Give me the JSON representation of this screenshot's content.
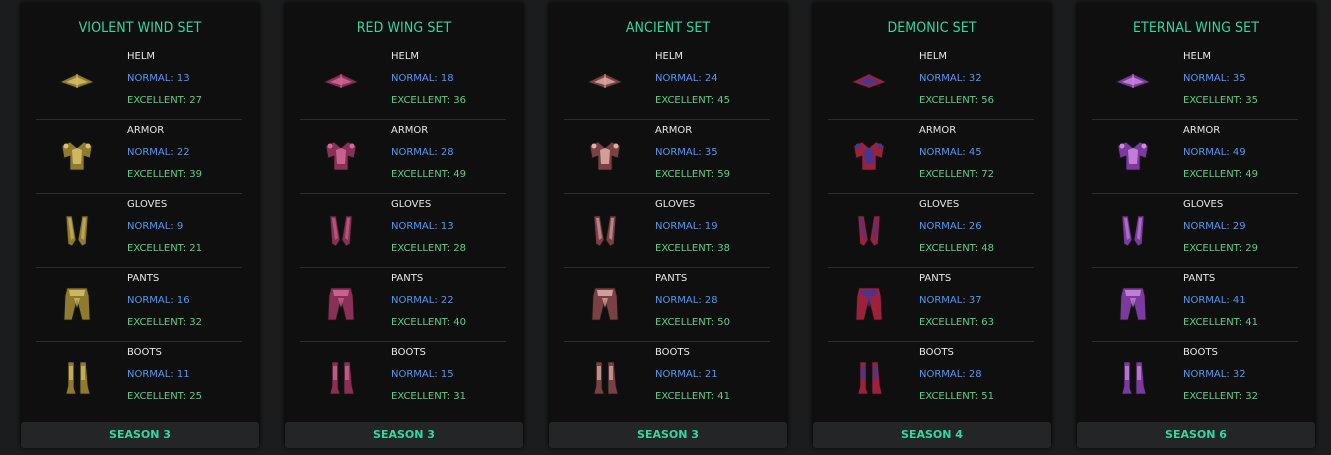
{
  "sets": [
    {
      "title": "VIOLENT WIND SET",
      "season": "SEASON 3",
      "colors": {
        "main": "#8f7a2d",
        "accent": "#d6c36a"
      },
      "items": [
        {
          "name": "HELM",
          "normal": "NORMAL: 13",
          "excellent": "EXCELLENT: 27",
          "icon": "helm-icon"
        },
        {
          "name": "ARMOR",
          "normal": "NORMAL: 22",
          "excellent": "EXCELLENT: 39",
          "icon": "armor-icon"
        },
        {
          "name": "GLOVES",
          "normal": "NORMAL: 9",
          "excellent": "EXCELLENT: 21",
          "icon": "gloves-icon"
        },
        {
          "name": "PANTS",
          "normal": "NORMAL: 16",
          "excellent": "EXCELLENT: 32",
          "icon": "pants-icon"
        },
        {
          "name": "BOOTS",
          "normal": "NORMAL: 11",
          "excellent": "EXCELLENT: 25",
          "icon": "boots-icon"
        }
      ]
    },
    {
      "title": "RED WING SET",
      "season": "SEASON 3",
      "colors": {
        "main": "#8a2f55",
        "accent": "#d46a9a"
      },
      "items": [
        {
          "name": "HELM",
          "normal": "NORMAL: 18",
          "excellent": "EXCELLENT: 36",
          "icon": "helm-icon"
        },
        {
          "name": "ARMOR",
          "normal": "NORMAL: 28",
          "excellent": "EXCELLENT: 49",
          "icon": "armor-icon"
        },
        {
          "name": "GLOVES",
          "normal": "NORMAL: 13",
          "excellent": "EXCELLENT: 28",
          "icon": "gloves-icon"
        },
        {
          "name": "PANTS",
          "normal": "NORMAL: 22",
          "excellent": "EXCELLENT: 40",
          "icon": "pants-icon"
        },
        {
          "name": "BOOTS",
          "normal": "NORMAL: 15",
          "excellent": "EXCELLENT: 31",
          "icon": "boots-icon"
        }
      ]
    },
    {
      "title": "ANCIENT SET",
      "season": "SEASON 3",
      "colors": {
        "main": "#7a4044",
        "accent": "#e0b0a8"
      },
      "items": [
        {
          "name": "HELM",
          "normal": "NORMAL: 24",
          "excellent": "EXCELLENT: 45",
          "icon": "helm-icon"
        },
        {
          "name": "ARMOR",
          "normal": "NORMAL: 35",
          "excellent": "EXCELLENT: 59",
          "icon": "armor-icon"
        },
        {
          "name": "GLOVES",
          "normal": "NORMAL: 19",
          "excellent": "EXCELLENT: 38",
          "icon": "gloves-icon"
        },
        {
          "name": "PANTS",
          "normal": "NORMAL: 28",
          "excellent": "EXCELLENT: 50",
          "icon": "pants-icon"
        },
        {
          "name": "BOOTS",
          "normal": "NORMAL: 21",
          "excellent": "EXCELLENT: 41",
          "icon": "boots-icon"
        }
      ]
    },
    {
      "title": "DEMONIC SET",
      "season": "SEASON 4",
      "colors": {
        "main": "#a0203a",
        "accent": "#3a3aa0"
      },
      "items": [
        {
          "name": "HELM",
          "normal": "NORMAL: 32",
          "excellent": "EXCELLENT: 56",
          "icon": "helm-icon"
        },
        {
          "name": "ARMOR",
          "normal": "NORMAL: 45",
          "excellent": "EXCELLENT: 72",
          "icon": "armor-icon"
        },
        {
          "name": "GLOVES",
          "normal": "NORMAL: 26",
          "excellent": "EXCELLENT: 48",
          "icon": "gloves-icon"
        },
        {
          "name": "PANTS",
          "normal": "NORMAL: 37",
          "excellent": "EXCELLENT: 63",
          "icon": "pants-icon"
        },
        {
          "name": "BOOTS",
          "normal": "NORMAL: 28",
          "excellent": "EXCELLENT: 51",
          "icon": "boots-icon"
        }
      ]
    },
    {
      "title": "ETERNAL WING SET",
      "season": "SEASON 6",
      "colors": {
        "main": "#7a3aa0",
        "accent": "#d08ae0"
      },
      "items": [
        {
          "name": "HELM",
          "normal": "NORMAL: 35",
          "excellent": "EXCELLENT: 35",
          "icon": "helm-icon"
        },
        {
          "name": "ARMOR",
          "normal": "NORMAL: 49",
          "excellent": "EXCELLENT: 49",
          "icon": "armor-icon"
        },
        {
          "name": "GLOVES",
          "normal": "NORMAL: 29",
          "excellent": "EXCELLENT: 29",
          "icon": "gloves-icon"
        },
        {
          "name": "PANTS",
          "normal": "NORMAL: 41",
          "excellent": "EXCELLENT: 41",
          "icon": "pants-icon"
        },
        {
          "name": "BOOTS",
          "normal": "NORMAL: 32",
          "excellent": "EXCELLENT: 32",
          "icon": "boots-icon"
        }
      ]
    }
  ]
}
